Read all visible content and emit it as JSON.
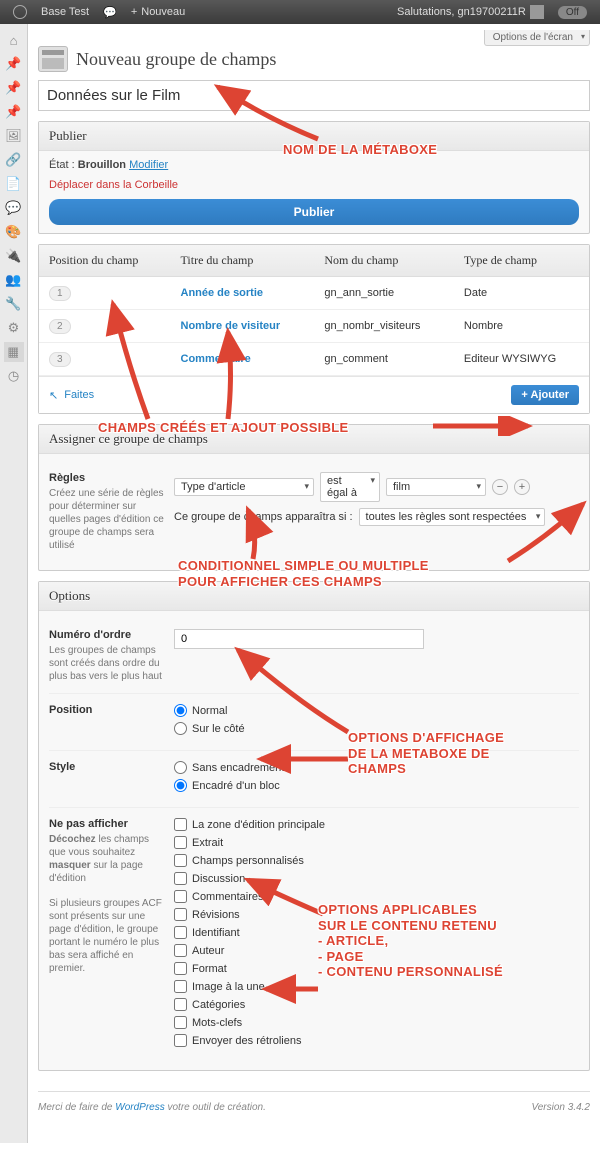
{
  "adminbar": {
    "site_name": "Base Test",
    "new_label": "Nouveau",
    "greeting": "Salutations, gn19700211R",
    "off": "Off"
  },
  "screen_options": "Options de l'écran",
  "page_title": "Nouveau groupe de champs",
  "title_field": {
    "value": "Données sur le Film"
  },
  "publish": {
    "box_title": "Publier",
    "status_prefix": "État :",
    "status_value": "Brouillon",
    "modify": "Modifier",
    "trash": "Déplacer dans la Corbeille",
    "button": "Publier"
  },
  "fields_table": {
    "headers": {
      "position": "Position du champ",
      "title": "Titre du champ",
      "name": "Nom du champ",
      "type": "Type de champ"
    },
    "rows": [
      {
        "pos": "1",
        "title": "Année de sortie",
        "name": "gn_ann_sortie",
        "type": "Date"
      },
      {
        "pos": "2",
        "title": "Nombre de visiteur",
        "name": "gn_nombr_visiteurs",
        "type": "Nombre"
      },
      {
        "pos": "3",
        "title": "Commentaire",
        "name": "gn_comment",
        "type": "Editeur WYSIWYG"
      }
    ],
    "drag_hint": "Faites",
    "add_button": "+ Ajouter"
  },
  "location": {
    "box_title": "Assigner ce groupe de champs",
    "rules_label": "Règles",
    "rules_desc": "Créez une série de règles pour déterminer sur quelles pages d'édition ce groupe de champs sera utilisé",
    "rule": {
      "param": "Type d'article",
      "operator": "est égal à",
      "value": "film"
    },
    "appear_label": "Ce groupe de champs apparaîtra si :",
    "appear_value": "toutes les règles sont respectées"
  },
  "options": {
    "box_title": "Options",
    "order": {
      "label": "Numéro d'ordre",
      "desc": "Les groupes de champs sont créés dans ordre du plus bas vers le plus haut",
      "value": "0"
    },
    "position": {
      "label": "Position",
      "opts": [
        "Normal",
        "Sur le côté"
      ],
      "selected": 0
    },
    "style": {
      "label": "Style",
      "opts": [
        "Sans encadrement",
        "Encadré d'un bloc"
      ],
      "selected": 1
    },
    "hide": {
      "label": "Ne pas afficher",
      "desc1_pre": "Décochez",
      "desc1_mid": " les champs que vous souhaitez ",
      "desc1_b": "masquer",
      "desc1_post": " sur la page d'édition",
      "desc2": "Si plusieurs groupes ACF sont présents sur une page d'édition, le groupe portant le numéro le plus bas sera affiché en premier.",
      "opts": [
        "La zone d'édition principale",
        "Extrait",
        "Champs personnalisés",
        "Discussion",
        "Commentaires",
        "Révisions",
        "Identifiant",
        "Auteur",
        "Format",
        "Image à la une",
        "Catégories",
        "Mots-clefs",
        "Envoyer des rétroliens"
      ]
    }
  },
  "annotations": {
    "a1": "NOM DE LA MÉTABOXE",
    "a2": "CHAMPS CRÉÉS ET AJOUT POSSIBLE",
    "a3": "CONDITIONNEL SIMPLE OU MULTIPLE\nPOUR AFFICHER CES CHAMPS",
    "a4": "OPTIONS D'AFFICHAGE\nDE LA METABOXE DE\nCHAMPS",
    "a5": "OPTIONS APPLICABLES\nSUR LE CONTENU RETENU\n- ARTICLE,\n- PAGE\n- CONTENU PERSONNALISÉ"
  },
  "footer": {
    "text_pre": "Merci de faire de ",
    "wp": "WordPress",
    "text_post": " votre outil de création.",
    "version": "Version 3.4.2"
  }
}
